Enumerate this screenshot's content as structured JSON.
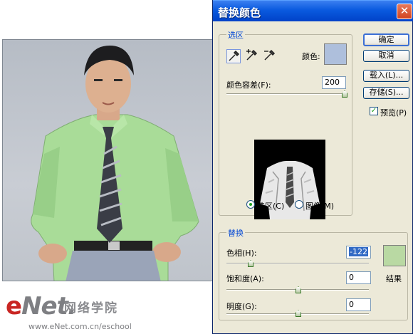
{
  "dialog": {
    "title": "替换颜色",
    "close_glyph": "✕",
    "selection_group": {
      "label": "选区",
      "color_label": "颜色:",
      "color_swatch": "#aebfdc",
      "tolerance_label": "颜色容差(F):",
      "tolerance_value": "200",
      "tolerance_level": 1.0,
      "radio_selection_label": "选区(C)",
      "radio_image_label": "图像(M)",
      "selected_radio": "selection"
    },
    "buttons": {
      "ok": "确定",
      "cancel": "取消",
      "load": "载入(L)...",
      "save": "存储(S)..."
    },
    "preview": {
      "label": "预览(P)",
      "checked": true,
      "check_glyph": "✓"
    },
    "replace_group": {
      "label": "替换",
      "hue_label": "色相(H):",
      "hue_value": "-122",
      "saturation_label": "饱和度(A):",
      "saturation_value": "0",
      "lightness_label": "明度(G):",
      "lightness_value": "0",
      "result_label": "结果",
      "result_swatch": "#b9d9a3"
    }
  },
  "watermark": {
    "logo_prefix": "e",
    "logo_rest": "Net",
    "logo_dot": ".",
    "chinese": "网络学院",
    "url": "www.eNet.com.cn/eschool"
  }
}
